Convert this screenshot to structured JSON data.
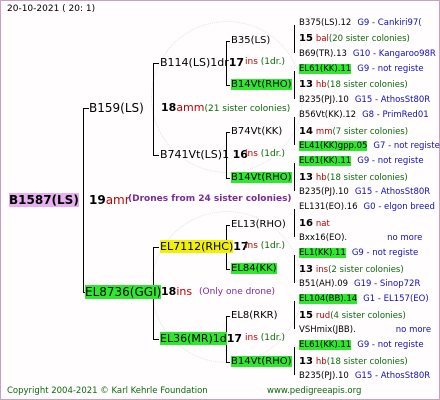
{
  "header": {
    "date": "20-10-2021 ( 20: 1)"
  },
  "root": {
    "name": "B1587(LS)",
    "num": "19",
    "code": "amr",
    "note": "(Drones from 24 sister colonies)"
  },
  "g1": [
    {
      "name": "B159(LS)",
      "num": "18",
      "code": "amm",
      "note": "(21 sister colonies)"
    },
    {
      "name": "EL8736(GGI)",
      "num": "18",
      "code": "ins",
      "note": "(Only one drone)"
    }
  ],
  "g2": [
    {
      "name": "B114(LS)1dr",
      "num": "17",
      "code": "ins",
      "note": "(1dr.)"
    },
    {
      "name": "B741Vt(LS)1",
      "num": "16",
      "code": "ins",
      "note": "(1dr.)"
    },
    {
      "name": "EL7112(RHC)",
      "num": "17",
      "code": "ins",
      "note": "(1dr.)"
    },
    {
      "name": "EL36(MR)1d",
      "num": "17",
      "code": "ins",
      "note": "(1dr.)"
    }
  ],
  "g3": [
    {
      "name": "B35(LS)",
      "num": "",
      "code": "",
      "note": ""
    },
    {
      "name": "B14Vt(RHO)",
      "num": "",
      "code": "",
      "note": ""
    },
    {
      "name": "B74Vt(KK)",
      "num": "",
      "code": "",
      "note": ""
    },
    {
      "name": "B14Vt(RHO)",
      "num": "",
      "code": "",
      "note": ""
    },
    {
      "name": "EL13(RHO)",
      "num": "",
      "code": "",
      "note": ""
    },
    {
      "name": "EL84(KK)",
      "num": "",
      "code": "",
      "note": ""
    },
    {
      "name": "EL8(RKR)",
      "num": "",
      "code": "",
      "note": ""
    },
    {
      "name": "B14Vt(RHO)",
      "num": "",
      "code": "",
      "note": ""
    }
  ],
  "g4": [
    {
      "name": "B375(LS).12",
      "extra": "G9 - Cankiri97(",
      "num": "",
      "code": ""
    },
    {
      "name": "",
      "extra": "",
      "num": "15",
      "code": "bal",
      "note": "(20 sister colonies)"
    },
    {
      "name": "B69(TR).13",
      "extra": "G10 - Kangaroo98R",
      "num": "",
      "code": ""
    },
    {
      "name": "EL61(KK).11",
      "extra": "G9 - not registe",
      "num": "",
      "code": ""
    },
    {
      "name": "",
      "extra": "",
      "num": "13",
      "code": "hb",
      "note": "(18 sister colonies)"
    },
    {
      "name": "B235(PJ).10",
      "extra": "G15 - AthosSt80R",
      "num": "",
      "code": ""
    },
    {
      "name": "B56Vt(KK).12",
      "extra": "G8 - PrimRed01",
      "num": "",
      "code": ""
    },
    {
      "name": "",
      "extra": "",
      "num": "14",
      "code": "mm",
      "note": "(7 sister colonies)"
    },
    {
      "name": "EL41(KK)gpp.05",
      "extra": "G7 - not registe",
      "num": "",
      "code": ""
    },
    {
      "name": "EL61(KK).11",
      "extra": "G9 - not registe",
      "num": "",
      "code": ""
    },
    {
      "name": "",
      "extra": "",
      "num": "13",
      "code": "hb",
      "note": "(18 sister colonies)"
    },
    {
      "name": "B235(PJ).10",
      "extra": "G15 - AthosSt80R",
      "num": "",
      "code": ""
    },
    {
      "name": "EL131(EO).16",
      "extra": "G0 - elgon breed",
      "num": "",
      "code": ""
    },
    {
      "name": "",
      "extra": "",
      "num": "16",
      "code": "nat",
      "note": ""
    },
    {
      "name": "Bxx16(EO).",
      "extra": "no more",
      "num": "",
      "code": ""
    },
    {
      "name": "EL1(KK).11",
      "extra": "G9 - not registe",
      "num": "",
      "code": ""
    },
    {
      "name": "",
      "extra": "",
      "num": "13",
      "code": "ins",
      "note": "(2 sister colonies)"
    },
    {
      "name": "B51(AH).09",
      "extra": "G19 - Sinop72R",
      "num": "",
      "code": ""
    },
    {
      "name": "EL104(BB).14",
      "extra": "G1 - EL157(EO)",
      "num": "",
      "code": ""
    },
    {
      "name": "",
      "extra": "",
      "num": "15",
      "code": "rud",
      "note": "(4 sister colonies)"
    },
    {
      "name": "VSHmix(JBB).",
      "extra": "no more",
      "num": "",
      "code": ""
    },
    {
      "name": "EL61(KK).11",
      "extra": "G9 - not registe",
      "num": "",
      "code": ""
    },
    {
      "name": "",
      "extra": "",
      "num": "13",
      "code": "hb",
      "note": "(18 sister colonies)"
    },
    {
      "name": "B235(PJ).10",
      "extra": "G15 - AthosSt80R",
      "num": "",
      "code": ""
    }
  ],
  "footer": {
    "copyright": "Copyright 2004-2021 © Karl Kehrle Foundation",
    "url": "www.pedigreeapis.org"
  }
}
